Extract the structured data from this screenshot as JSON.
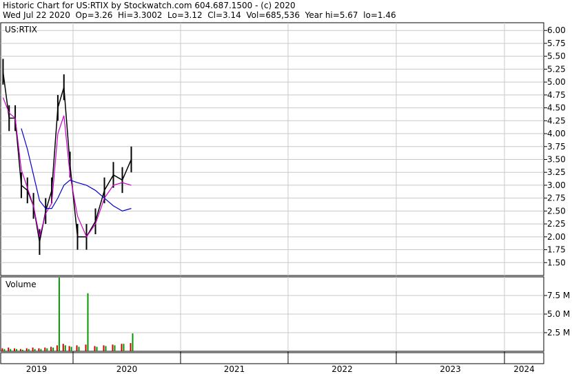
{
  "header": {
    "line1": "Historic Chart for US:RTIX by Stockwatch.com 604.687.1500 - (c) 2020",
    "line2": "Wed Jul 22 2020  Op=3.26  Hi=3.3002  Lo=3.12  Cl=3.14  Vol=685,536  Year hi=5.67  lo=1.46"
  },
  "chart_data": [
    {
      "type": "line",
      "title": "US:RTIX",
      "y_tick_labels": [
        "6.00",
        "5.75",
        "5.50",
        "5.25",
        "5.00",
        "4.75",
        "4.50",
        "4.25",
        "4.00",
        "3.75",
        "3.50",
        "3.25",
        "3.00",
        "2.75",
        "2.50",
        "2.25",
        "2.00",
        "1.75",
        "1.50"
      ],
      "ylim": [
        1.25,
        6.15
      ],
      "x_tick_labels": [
        "2019",
        "2020",
        "2021",
        "2022",
        "2023",
        "2024"
      ],
      "grid": true,
      "series": [
        {
          "style": "price-high-low-bars",
          "color": "#000000",
          "x": [
            "2019-01",
            "2019-02",
            "2019-03",
            "2019-04",
            "2019-05",
            "2019-06",
            "2019-07",
            "2019-08",
            "2019-09",
            "2019-10",
            "2019-11",
            "2019-12",
            "2020-01",
            "2020-02",
            "2020-03",
            "2020-04",
            "2020-05",
            "2020-06",
            "2020-07"
          ],
          "values": [
            5.2,
            4.3,
            4.3,
            3.0,
            2.9,
            2.6,
            1.9,
            2.5,
            2.9,
            4.5,
            4.9,
            3.4,
            2.0,
            2.0,
            2.3,
            2.9,
            3.2,
            3.1,
            3.5
          ]
        },
        {
          "style": "moving-average",
          "color": "#cc00cc",
          "x": [
            "2019-01",
            "2019-02",
            "2019-03",
            "2019-04",
            "2019-05",
            "2019-06",
            "2019-07",
            "2019-08",
            "2019-09",
            "2019-10",
            "2019-11",
            "2019-12",
            "2020-01",
            "2020-02",
            "2020-03",
            "2020-04",
            "2020-05",
            "2020-06",
            "2020-07"
          ],
          "values": [
            4.7,
            4.4,
            4.3,
            3.3,
            2.95,
            2.6,
            2.0,
            2.45,
            2.65,
            4.0,
            4.35,
            3.2,
            2.4,
            2.0,
            2.25,
            2.75,
            3.0,
            3.05,
            3.0
          ]
        },
        {
          "style": "moving-average",
          "color": "#0000cc",
          "x": [
            "2019-04",
            "2019-05",
            "2019-06",
            "2019-07",
            "2019-08",
            "2019-09",
            "2019-10",
            "2019-11",
            "2019-12",
            "2020-01",
            "2020-02",
            "2020-03",
            "2020-04",
            "2020-05",
            "2020-06",
            "2020-07"
          ],
          "values": [
            4.1,
            3.7,
            3.2,
            2.7,
            2.55,
            2.55,
            2.75,
            3.0,
            3.1,
            3.05,
            3.0,
            2.9,
            2.75,
            2.6,
            2.5,
            2.55
          ]
        }
      ]
    },
    {
      "type": "bar",
      "title": "Volume",
      "y_tick_labels": [
        "7.5 M",
        "5.0 M",
        "2.5 M"
      ],
      "ylim": [
        0,
        10
      ],
      "x": [
        "2019-01",
        "2019-02",
        "2019-03",
        "2019-04",
        "2019-05",
        "2019-06",
        "2019-07",
        "2019-08",
        "2019-09",
        "2019-10",
        "2019-11",
        "2019-12",
        "2020-01",
        "2020-02",
        "2020-03",
        "2020-04",
        "2020-05",
        "2020-06",
        "2020-07"
      ],
      "series": [
        {
          "name": "",
          "color": "#cc0000",
          "values": [
            0.4,
            0.5,
            0.4,
            0.3,
            0.4,
            0.5,
            0.4,
            0.5,
            0.6,
            0.8,
            1.0,
            0.7,
            0.8,
            0.9,
            0.7,
            0.8,
            0.9,
            1.0,
            1.1
          ]
        },
        {
          "name": "",
          "color": "#009900",
          "values": [
            0.3,
            0.3,
            0.3,
            0.2,
            0.3,
            0.3,
            0.3,
            0.4,
            0.5,
            9.9,
            0.8,
            0.6,
            0.6,
            7.8,
            0.6,
            0.7,
            0.8,
            1.0,
            2.4
          ]
        }
      ]
    }
  ]
}
